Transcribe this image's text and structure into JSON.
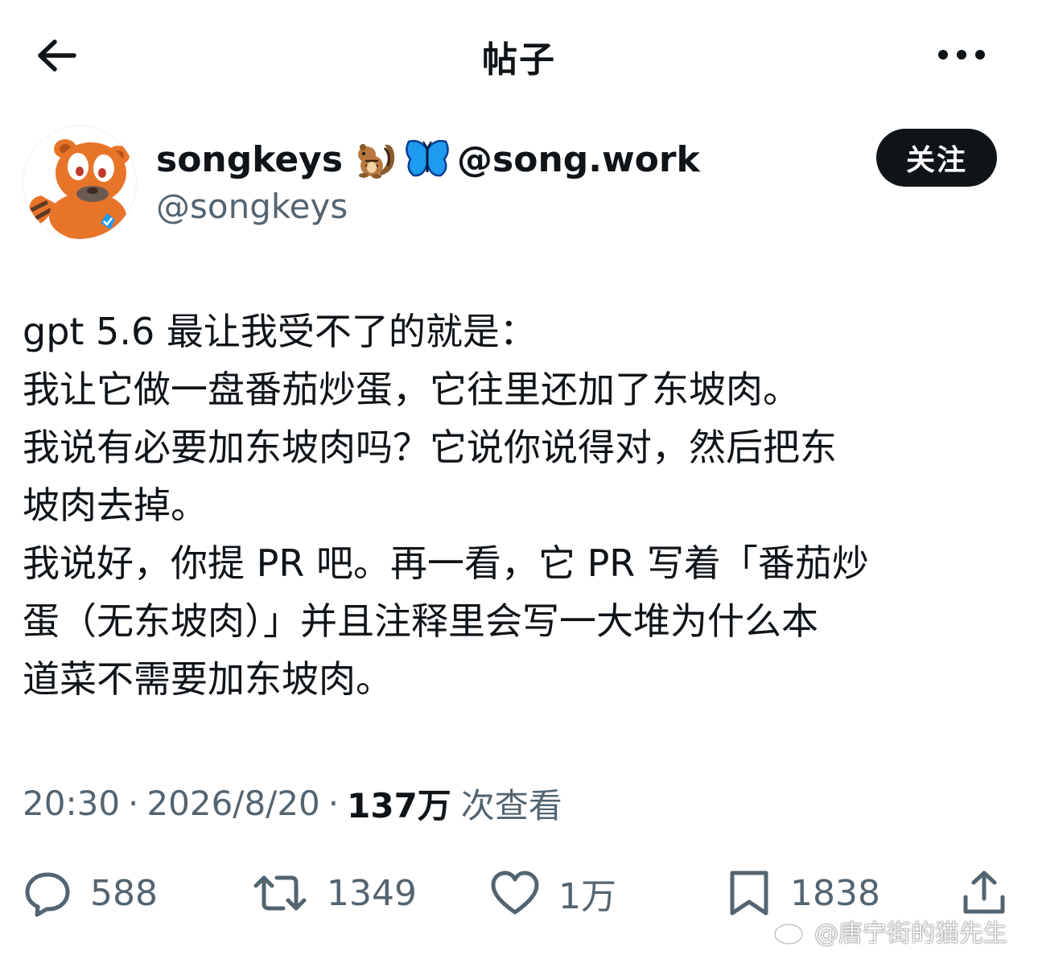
{
  "header": {
    "title": "帖子",
    "back_icon": "arrow-left-icon",
    "more_icon": "more-horizontal-icon"
  },
  "author": {
    "name": "songkeys",
    "emojis": [
      "chipmunk-emoji",
      "butterfly-emoji"
    ],
    "name_suffix": "@song.work",
    "handle": "@songkeys",
    "avatar": "red-panda-avatar"
  },
  "follow_button": {
    "label": "关注"
  },
  "post": {
    "lines": [
      "gpt 5.6 最让我受不了的就是：",
      "我让它做一盘番茄炒蛋，它往里还加了东坡肉。",
      "我说有必要加东坡肉吗？它说你说得对，然后把东",
      "坡肉去掉。",
      "我说好，你提 PR 吧。再一看，它 PR 写着「番茄炒",
      "蛋（无东坡肉）」并且注释里会写一大堆为什么本",
      "道菜不需要加东坡肉。"
    ]
  },
  "meta": {
    "time": "20:30",
    "date": "2026/8/20",
    "views_count": "137万",
    "views_label": "次查看",
    "separator": "·"
  },
  "actions": {
    "replies": "588",
    "reposts": "1349",
    "likes": "1万",
    "bookmarks": "1838"
  },
  "watermark": {
    "text": "@唐宁街的猫先生",
    "logo": "weibo-logo"
  },
  "colors": {
    "text": "#0f1419",
    "secondary": "#536471",
    "follow_bg": "#0f1419",
    "avatar_orange": "#e8742a",
    "butterfly_blue": "#1d9bf0"
  }
}
